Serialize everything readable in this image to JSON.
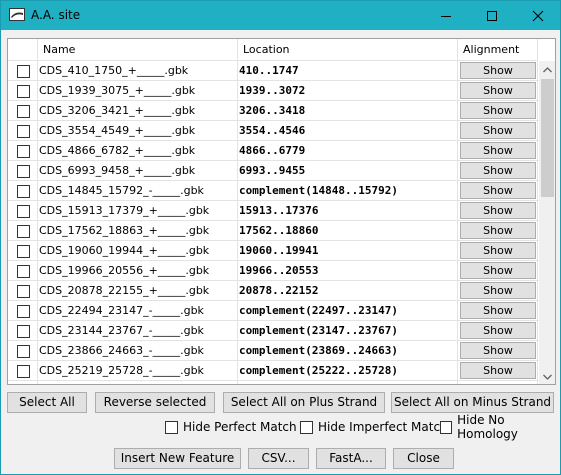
{
  "window": {
    "title": "A.A. site"
  },
  "table": {
    "headers": [
      "Name",
      "Location",
      "Alignment"
    ],
    "rows": [
      {
        "name": "CDS_410_1750_+_____.gbk",
        "location": "410..1747",
        "action": "Show"
      },
      {
        "name": "CDS_1939_3075_+_____.gbk",
        "location": "1939..3072",
        "action": "Show"
      },
      {
        "name": "CDS_3206_3421_+_____.gbk",
        "location": "3206..3418",
        "action": "Show"
      },
      {
        "name": "CDS_3554_4549_+_____.gbk",
        "location": "3554..4546",
        "action": "Show"
      },
      {
        "name": "CDS_4866_6782_+_____.gbk",
        "location": "4866..6779",
        "action": "Show"
      },
      {
        "name": "CDS_6993_9458_+_____.gbk",
        "location": "6993..9455",
        "action": "Show"
      },
      {
        "name": "CDS_14845_15792_-_____.gbk",
        "location": "complement(14848..15792)",
        "action": "Show"
      },
      {
        "name": "CDS_15913_17379_+_____.gbk",
        "location": "15913..17376",
        "action": "Show"
      },
      {
        "name": "CDS_17562_18863_+_____.gbk",
        "location": "17562..18860",
        "action": "Show"
      },
      {
        "name": "CDS_19060_19944_+_____.gbk",
        "location": "19060..19941",
        "action": "Show"
      },
      {
        "name": "CDS_19966_20556_+_____.gbk",
        "location": "19966..20553",
        "action": "Show"
      },
      {
        "name": "CDS_20878_22155_+_____.gbk",
        "location": "20878..22152",
        "action": "Show"
      },
      {
        "name": "CDS_22494_23147_-_____.gbk",
        "location": "complement(22497..23147)",
        "action": "Show"
      },
      {
        "name": "CDS_23144_23767_-_____.gbk",
        "location": "complement(23147..23767)",
        "action": "Show"
      },
      {
        "name": "CDS_23866_24663_-_____.gbk",
        "location": "complement(23869..24663)",
        "action": "Show"
      },
      {
        "name": "CDS_25219_25728_-_____.gbk",
        "location": "complement(25222..25728)",
        "action": "Show"
      }
    ]
  },
  "selection_buttons": {
    "select_all": "Select All",
    "reverse_selected": "Reverse selected",
    "select_plus": "Select All on Plus Strand",
    "select_minus": "Select All on Minus Strand"
  },
  "filters": {
    "hide_perfect": "Hide Perfect Match",
    "hide_imperfect": "Hide Imperfect Match",
    "hide_no_homology": "Hide No Homology"
  },
  "footer_buttons": {
    "insert": "Insert New Feature",
    "csv": "CSV...",
    "fasta": "FastA...",
    "close": "Close"
  }
}
